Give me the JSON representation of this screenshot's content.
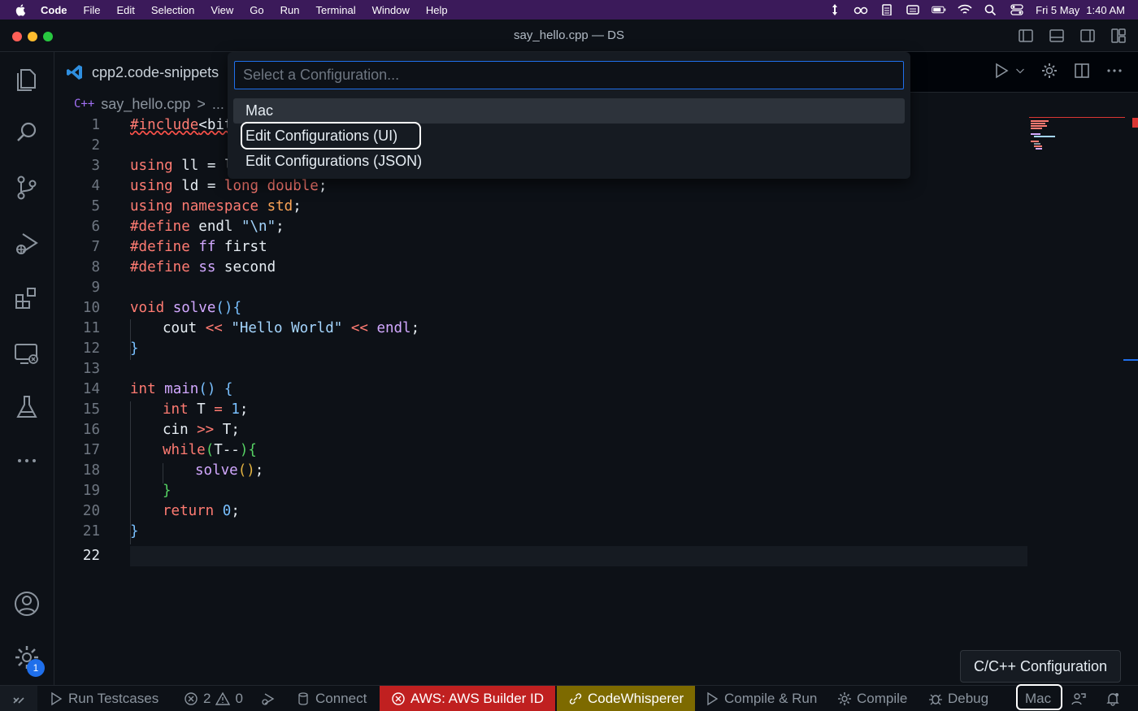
{
  "menubar": {
    "app_name": "Code",
    "items": [
      "File",
      "Edit",
      "Selection",
      "View",
      "Go",
      "Run",
      "Terminal",
      "Window",
      "Help"
    ],
    "date": "Fri 5 May",
    "time": "1:40 AM"
  },
  "window": {
    "title": "say_hello.cpp — DS"
  },
  "tab": {
    "label": "cpp2.code-snippets"
  },
  "breadcrumb": {
    "file_icon": "C++",
    "file": "say_hello.cpp",
    "separator": ">",
    "more": "..."
  },
  "code": {
    "active_line": 22,
    "lines": [
      {
        "n": "1"
      },
      {
        "n": "2"
      },
      {
        "n": "3"
      },
      {
        "n": "4"
      },
      {
        "n": "5"
      },
      {
        "n": "6"
      },
      {
        "n": "7"
      },
      {
        "n": "8"
      },
      {
        "n": "9"
      },
      {
        "n": "10"
      },
      {
        "n": "11"
      },
      {
        "n": "12"
      },
      {
        "n": "13"
      },
      {
        "n": "14"
      },
      {
        "n": "15"
      },
      {
        "n": "16"
      },
      {
        "n": "17"
      },
      {
        "n": "18"
      },
      {
        "n": "19"
      },
      {
        "n": "20"
      },
      {
        "n": "21"
      },
      {
        "n": "22"
      }
    ],
    "tokens": {
      "l1": [
        "#include",
        "<bit"
      ],
      "l3": [
        "using",
        " ll = l"
      ],
      "l4": [
        "using",
        " ld = ",
        "long double",
        ";"
      ],
      "l5": [
        "using namespace",
        " ",
        "std",
        ";"
      ],
      "l6": [
        "#define",
        " endl ",
        "\"\\n\"",
        ";"
      ],
      "l7": [
        "#define",
        " ",
        "ff",
        " first"
      ],
      "l8": [
        "#define",
        " ",
        "ss",
        " second"
      ],
      "l10": [
        "void",
        " ",
        "solve",
        "()",
        "{"
      ],
      "l11": [
        "cout",
        " << ",
        "\"Hello World\"",
        " << ",
        "endl",
        ";"
      ],
      "l12": [
        "}"
      ],
      "l14": [
        "int",
        " ",
        "main",
        "()",
        " {"
      ],
      "l15": [
        "int",
        " T ",
        "=",
        " ",
        "1",
        ";"
      ],
      "l16": [
        "cin",
        " >> ",
        "T",
        ";"
      ],
      "l17": [
        "while",
        "(",
        "T--",
        ")",
        "{"
      ],
      "l18": [
        "solve",
        "()",
        ";"
      ],
      "l19": [
        "}"
      ],
      "l20": [
        "return",
        " ",
        "0",
        ";"
      ],
      "l21": [
        "}"
      ]
    }
  },
  "quickpick": {
    "placeholder": "Select a Configuration...",
    "items": [
      "Mac",
      "Edit Configurations (UI)",
      "Edit Configurations (JSON)"
    ],
    "selected_index": 0
  },
  "statusbar": {
    "run_testcases": "Run Testcases",
    "errors": "2",
    "warnings": "0",
    "connect": "Connect",
    "aws": "AWS: AWS Builder ID",
    "codewhisperer": "CodeWhisperer",
    "compile_run": "Compile & Run",
    "compile": "Compile",
    "debug": "Debug",
    "config": "Mac"
  },
  "tooltip": {
    "text": "C/C++ Configuration"
  },
  "activity": {
    "settings_badge": "1",
    "icons": [
      "explorer-icon",
      "search-icon",
      "source-control-icon",
      "run-debug-icon",
      "extensions-icon",
      "remote-explorer-icon",
      "testing-icon",
      "more-icon",
      "account-icon",
      "manage-gear-icon"
    ]
  },
  "colors": {
    "accent": "#1f6feb",
    "aws_bg": "#c02020",
    "codewhisperer_bg": "#7d6a00",
    "menubar_bg": "#3b1a5a"
  }
}
